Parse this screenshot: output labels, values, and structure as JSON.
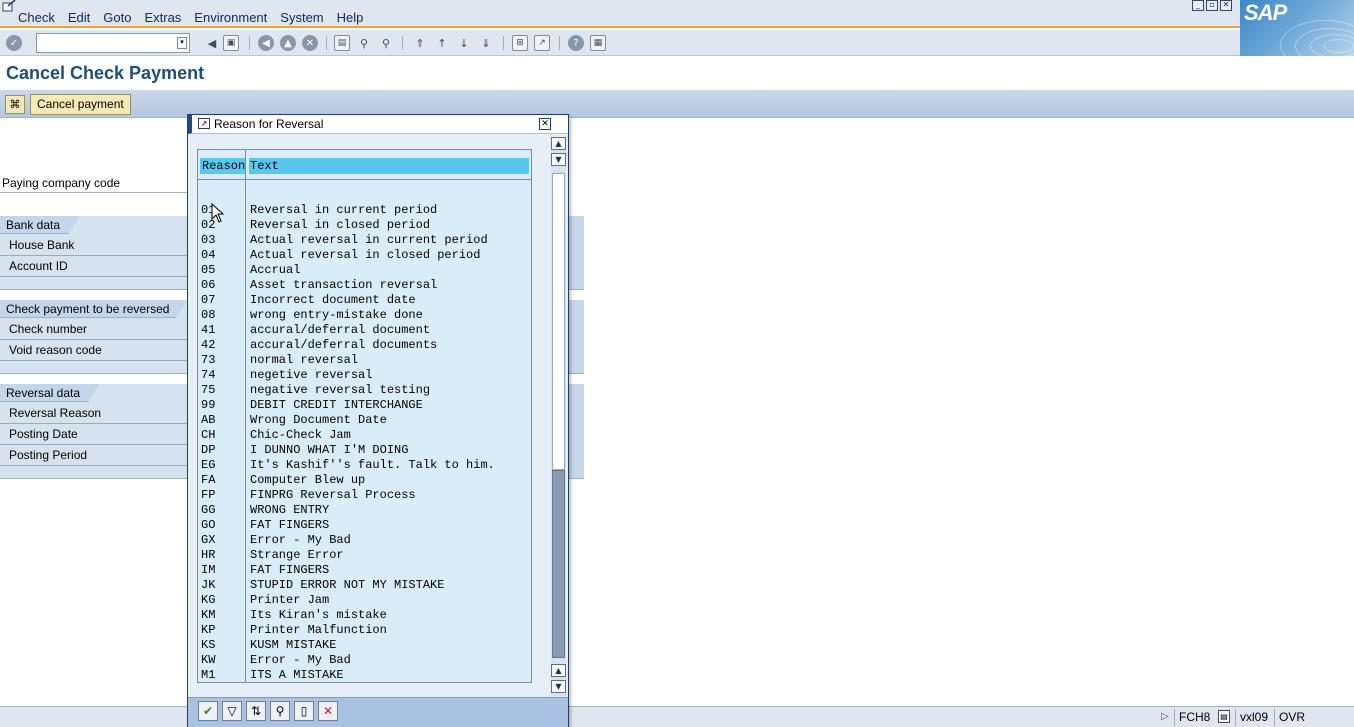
{
  "menu": {
    "items": [
      "Check",
      "Edit",
      "Goto",
      "Extras",
      "Environment",
      "System",
      "Help"
    ]
  },
  "logo": {
    "text": "SAP"
  },
  "toolbar": {
    "command_field_value": "",
    "icons": [
      "enter-icon",
      "back-icon",
      "save-icon",
      "back-nav-icon",
      "exit-icon",
      "cancel-icon",
      "print-icon",
      "find-icon",
      "find-next-icon",
      "first-page-icon",
      "previous-page-icon",
      "next-page-icon",
      "last-page-icon",
      "create-session-icon",
      "shortcut-icon",
      "help-icon",
      "layout-icon"
    ]
  },
  "page": {
    "title": "Cancel Check Payment",
    "cancel_button": "Cancel payment"
  },
  "form": {
    "paying_company_code": "Paying company code",
    "groups": [
      {
        "title": "Bank data",
        "fields": [
          "House Bank",
          "Account ID"
        ]
      },
      {
        "title": "Check payment to be reversed",
        "fields": [
          "Check number",
          "Void reason code"
        ]
      },
      {
        "title": "Reversal data",
        "fields": [
          "Reversal Reason",
          "Posting Date",
          "Posting Period"
        ]
      }
    ]
  },
  "popup": {
    "title": "Reason for Reversal",
    "columns": {
      "reason": "Reason",
      "text": "Text"
    },
    "rows": [
      {
        "code": "01",
        "text": "Reversal in current period"
      },
      {
        "code": "02",
        "text": "Reversal in closed period"
      },
      {
        "code": "03",
        "text": "Actual reversal in current period"
      },
      {
        "code": "04",
        "text": "Actual reversal in closed period"
      },
      {
        "code": "05",
        "text": "Accrual"
      },
      {
        "code": "06",
        "text": "Asset transaction reversal"
      },
      {
        "code": "07",
        "text": "Incorrect document date"
      },
      {
        "code": "08",
        "text": "wrong entry-mistake done"
      },
      {
        "code": "41",
        "text": "accural/deferral document"
      },
      {
        "code": "42",
        "text": "accural/deferral documents"
      },
      {
        "code": "73",
        "text": "normal reversal"
      },
      {
        "code": "74",
        "text": "negetive reversal"
      },
      {
        "code": "75",
        "text": "negative reversal testing"
      },
      {
        "code": "99",
        "text": "DEBIT CREDIT INTERCHANGE"
      },
      {
        "code": "AB",
        "text": "Wrong Document Date"
      },
      {
        "code": "CH",
        "text": "Chic-Check Jam"
      },
      {
        "code": "DP",
        "text": "I DUNNO WHAT I'M DOING"
      },
      {
        "code": "EG",
        "text": "It's Kashif''s fault. Talk to him."
      },
      {
        "code": "FA",
        "text": "Computer Blew up"
      },
      {
        "code": "FP",
        "text": "FINPRG Reversal Process"
      },
      {
        "code": "GG",
        "text": "WRONG ENTRY"
      },
      {
        "code": "GO",
        "text": "FAT FINGERS"
      },
      {
        "code": "GX",
        "text": "Error - My Bad"
      },
      {
        "code": "HR",
        "text": "Strange Error"
      },
      {
        "code": "IM",
        "text": "FAT FINGERS"
      },
      {
        "code": "JK",
        "text": "STUPID ERROR NOT MY MISTAKE"
      },
      {
        "code": "KG",
        "text": "Printer Jam"
      },
      {
        "code": "KM",
        "text": "Its Kiran's mistake"
      },
      {
        "code": "KP",
        "text": "Printer Malfunction"
      },
      {
        "code": "KS",
        "text": "KUSM MISTAKE"
      },
      {
        "code": "KW",
        "text": "Error - My Bad"
      },
      {
        "code": "M1",
        "text": "ITS A MISTAKE"
      }
    ],
    "footer_icons": [
      "continue-icon",
      "filter-icon",
      "sort-icon",
      "find-icon",
      "new-entry-icon",
      "cancel-icon"
    ]
  },
  "status": {
    "transaction": "FCH8",
    "server": "vxl09",
    "mode": "OVR"
  },
  "colors": {
    "title": "#1f4e79",
    "header_highlight": "#58c8f1",
    "list_background": "#d9edf9",
    "cancel_red": "#cc1a1a",
    "continue_green": "#2f8f1e"
  }
}
